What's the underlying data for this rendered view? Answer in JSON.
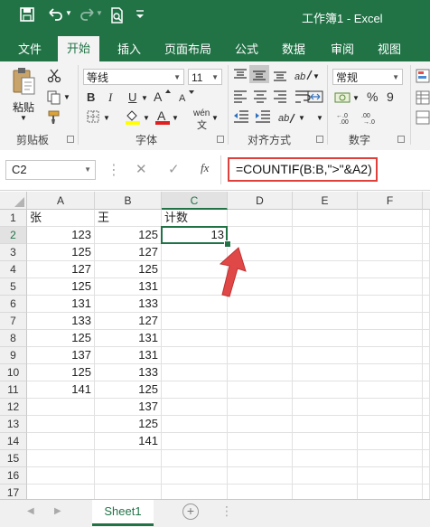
{
  "colors": {
    "brand": "#217346",
    "highlight_box": "#e0403c",
    "arrow": "#e0403c"
  },
  "titlebar": {
    "title": "工作簿1 - Excel",
    "icons": [
      "save-icon",
      "undo-icon",
      "redo-icon",
      "print-preview-icon",
      "qat-dropdown-icon"
    ]
  },
  "tabs": [
    "文件",
    "开始",
    "插入",
    "页面布局",
    "公式",
    "数据",
    "审阅",
    "视图"
  ],
  "active_tab": "开始",
  "ribbon": {
    "clipboard": {
      "paste_label": "粘贴",
      "group_label": "剪贴板"
    },
    "font": {
      "font_name": "等线",
      "font_size": "11",
      "bold": "B",
      "italic": "I",
      "underline": "U",
      "phonetic": "wén",
      "font_color_glyph": "A",
      "group_label": "字体"
    },
    "alignment": {
      "group_label": "对齐方式"
    },
    "number": {
      "format": "常规",
      "percent": "%",
      "comma": "9",
      "group_label": "数字"
    }
  },
  "formula_bar": {
    "name_box": "C2",
    "fx": "fx",
    "cancel": "✕",
    "enter": "✓",
    "formula": "=COUNTIF(B:B,\">\"&A2)"
  },
  "grid": {
    "columns": [
      "A",
      "B",
      "C",
      "D",
      "E",
      "F"
    ],
    "selected_column": "C",
    "selected_row": "2",
    "rows": [
      "1",
      "2",
      "3",
      "4",
      "5",
      "6",
      "7",
      "8",
      "9",
      "10",
      "11",
      "12",
      "13",
      "14",
      "15",
      "16",
      "17"
    ],
    "headers": {
      "A": "张",
      "B": "王",
      "C": "计数"
    },
    "A": [
      "123",
      "125",
      "127",
      "125",
      "131",
      "133",
      "125",
      "137",
      "125",
      "141"
    ],
    "B": [
      "125",
      "127",
      "125",
      "131",
      "133",
      "127",
      "131",
      "131",
      "133",
      "125",
      "137",
      "125",
      "141"
    ],
    "C2": "13"
  },
  "sheet_tabs": [
    "Sheet1"
  ],
  "add_sheet": "+"
}
